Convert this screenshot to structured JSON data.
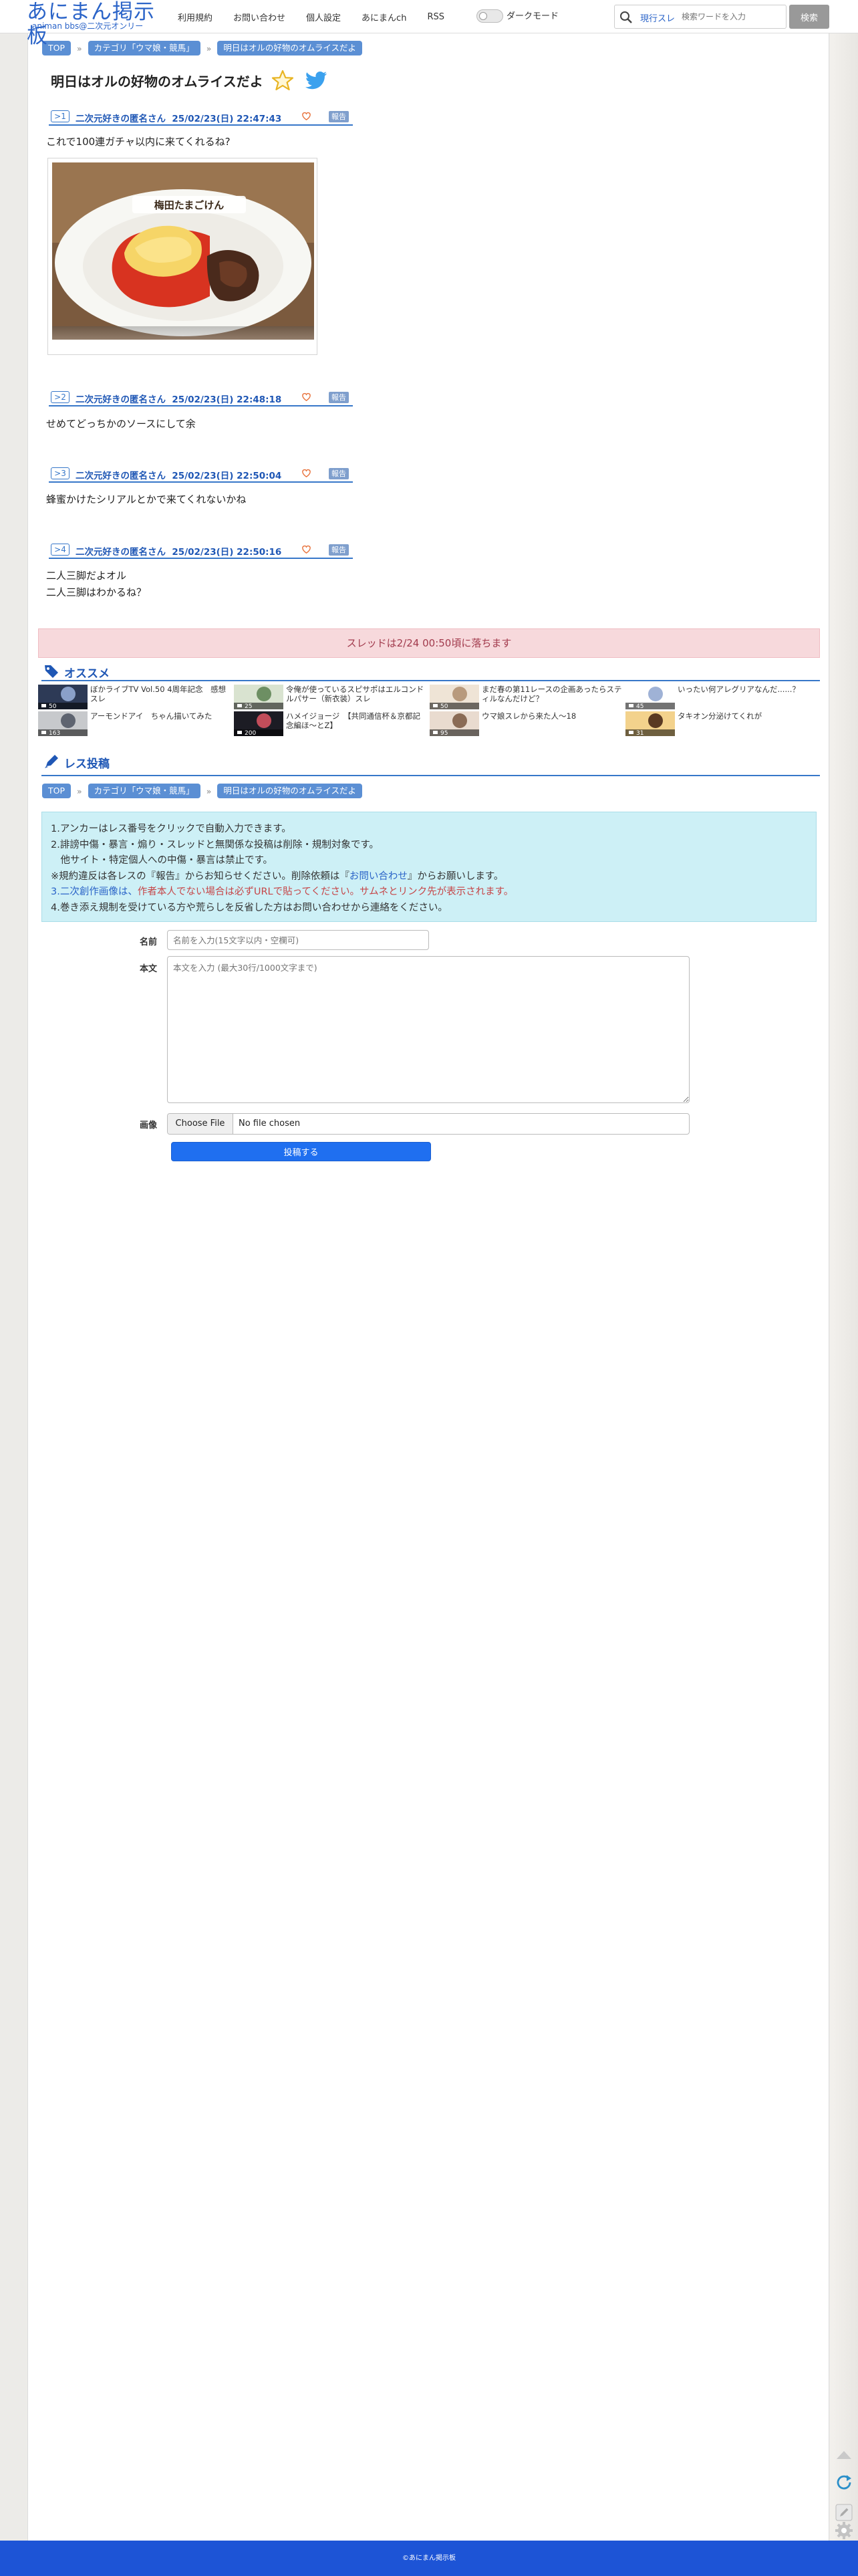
{
  "header": {
    "logo_main": "あにまん掲示板",
    "logo_sub": "animan bbs@二次元オンリー",
    "nav": [
      "利用規約",
      "お問い合わせ",
      "個人設定",
      "あにまんch",
      "RSS"
    ],
    "dark_mode_label": "ダークモード",
    "search_scope": "現行スレ",
    "search_placeholder": "検索ワードを入力",
    "search_button": "検索"
  },
  "breadcrumb": {
    "top": "TOP",
    "category": "カテゴリ「ウマ娘・競馬」",
    "thread": "明日はオルの好物のオムライスだよ"
  },
  "thread_title": "明日はオルの好物のオムライスだよ",
  "posts": [
    {
      "num": ">1",
      "name": "二次元好きの匿名さん",
      "date": "25/02/23(日) 22:47:43",
      "report": "報告",
      "body": [
        "これで100連ガチャ以内に来てくれるね?"
      ],
      "image_text": "梅田たまごけん"
    },
    {
      "num": ">2",
      "name": "二次元好きの匿名さん",
      "date": "25/02/23(日) 22:48:18",
      "report": "報告",
      "body": [
        "せめてどっちかのソースにして余"
      ]
    },
    {
      "num": ">3",
      "name": "二次元好きの匿名さん",
      "date": "25/02/23(日) 22:50:04",
      "report": "報告",
      "body": [
        "蜂蜜かけたシリアルとかで来てくれないかね"
      ]
    },
    {
      "num": ">4",
      "name": "二次元好きの匿名さん",
      "date": "25/02/23(日) 22:50:16",
      "report": "報告",
      "body": [
        "二人三脚だよオル",
        "二人三脚はわかるね？"
      ]
    }
  ],
  "fall_notice": "スレッドは2/24 00:50頃に落ちます",
  "recommend": {
    "heading": "オススメ",
    "items": [
      {
        "title": "ぼかライブTV Vol.50 4周年記念　感想スレ",
        "count": "50"
      },
      {
        "title": "令俺が使っているスピサポはエルコンドルパサー（新衣装）スレ",
        "count": "25"
      },
      {
        "title": "まだ春の第11レースの企画あったらスティルなんだけど？",
        "count": "50"
      },
      {
        "title": "いったい何アレグリアなんだ......？",
        "count": "45"
      },
      {
        "title": "アーモンドアイ　ちゃん描いてみた",
        "count": "163"
      },
      {
        "title": "ハメイジョージ　【共同通信杯＆京都記念編ほ～とZ】",
        "count": "200"
      },
      {
        "title": "ウマ娘スレから来た人～18",
        "count": "95"
      },
      {
        "title": "タキオン分泌けてくれが",
        "count": "31"
      }
    ]
  },
  "reply": {
    "heading": "レス投稿",
    "rules": [
      "1.アンカーはレス番号をクリックで自動入力できます。",
      "2.誹謗中傷・暴言・煽り・スレッドと無関係な投稿は削除・規制対象です。",
      "　他サイト・特定個人への中傷・暴言は禁止です。",
      "※規約違反は各レスの『報告』からお知らせください。削除依頼は『",
      "お問い合わせ",
      "』からお願いします。",
      "3.二次創作画像は、",
      "作者本人でない場合は必ずURLで貼ってください。サムネとリンク先が表示されます。",
      "4.巻き添え規制を受けている方や荒らしを反省した方はお問い合わせから連絡をください。"
    ],
    "name_label": "名前",
    "name_placeholder": "名前を入力(15文字以内・空欄可)",
    "body_label": "本文",
    "body_placeholder": "本文を入力 (最大30行/1000文字まで)",
    "image_label": "画像",
    "file_button": "Choose File",
    "file_none": "No file chosen",
    "submit": "投稿する"
  },
  "footer": "©あにまん掲示板",
  "colors": {
    "brand": "#2b64c8",
    "accent": "#3777c9",
    "notice_bg": "#f7d9dc",
    "footer": "#1d54d6"
  }
}
